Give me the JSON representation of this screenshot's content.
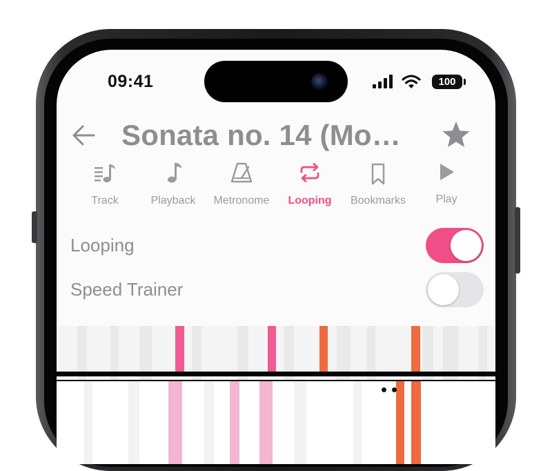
{
  "status_bar": {
    "time": "09:41",
    "battery": "100",
    "icons": [
      "signal-icon",
      "wifi-icon",
      "battery-icon"
    ]
  },
  "header": {
    "back_icon": "arrow-left-icon",
    "title": "Sonata no. 14 (Mo…",
    "favorite_icon": "star-icon"
  },
  "tabs": [
    {
      "label": "Track",
      "icon": "track-icon",
      "active": false
    },
    {
      "label": "Playback",
      "icon": "music-note-icon",
      "active": false
    },
    {
      "label": "Metronome",
      "icon": "metronome-icon",
      "active": false
    },
    {
      "label": "Looping",
      "icon": "loop-icon",
      "active": true
    },
    {
      "label": "Bookmarks",
      "icon": "bookmark-icon",
      "active": false
    },
    {
      "label": "Play",
      "icon": "play-icon",
      "active": false
    }
  ],
  "settings": [
    {
      "label": "Looping",
      "enabled": true
    },
    {
      "label": "Speed Trainer",
      "enabled": false
    }
  ],
  "colors": {
    "accent": "#ef4f86",
    "loop_marker": "#ef5b93",
    "loop_marker_light": "#f3b6d0",
    "bookmark_marker": "#ef6a3e",
    "label_gray": "#8e8e92"
  }
}
